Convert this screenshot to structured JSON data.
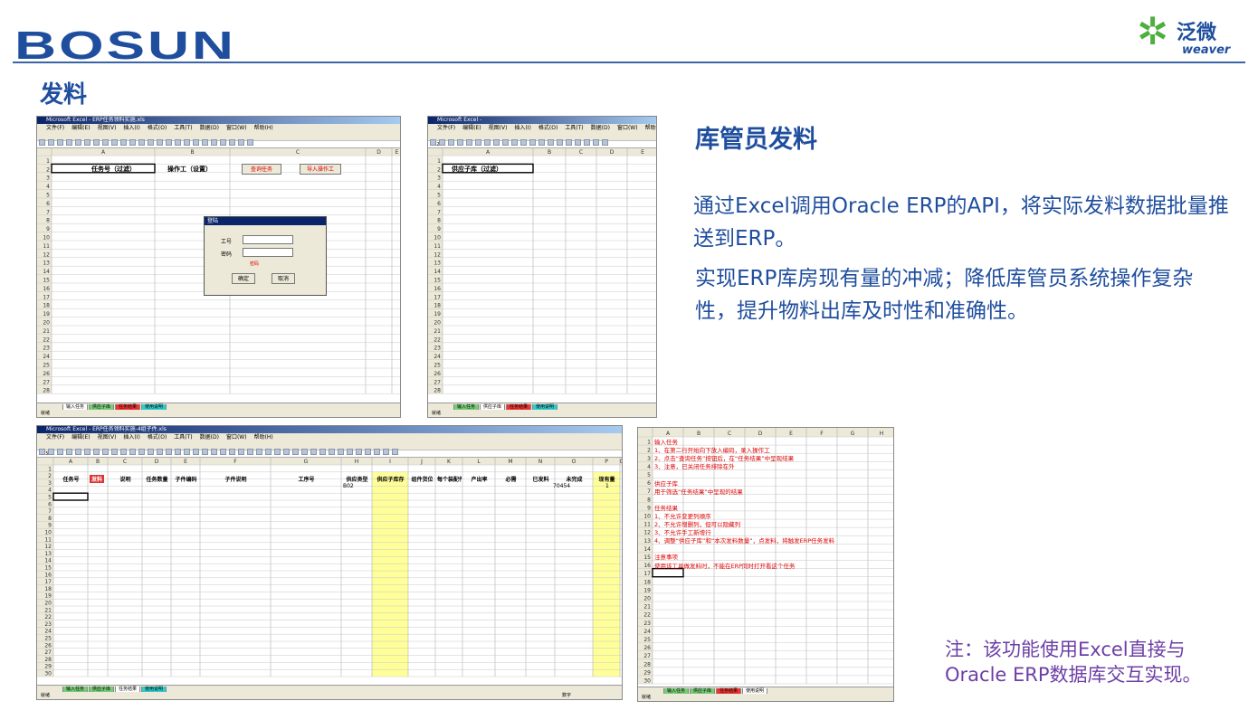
{
  "header": {
    "brand": "BOSUN",
    "logo_cn": "泛微",
    "logo_en": "weaver",
    "section": "发料"
  },
  "right": {
    "title": "库管员发料",
    "p1": "通过Excel调用Oracle ERP的API，将实际发料数据批量推送到ERP。",
    "p2": "实现ERP库房现有量的冲减；降低库管员系统操作复杂性，提升物料出库及时性和准确性。"
  },
  "note": {
    "l1": "注：该功能使用Excel直接与",
    "l2": "Oracle ERP数据库交互实现。"
  },
  "colors": {
    "brand": "#1f4e9e",
    "note": "#6d3fa6",
    "highlight": "#ffff99"
  },
  "common": {
    "title": "Microsoft Excel - ERP任务领料实施.xls",
    "menus": [
      "文件(F)",
      "编辑(E)",
      "视图(V)",
      "插入(I)",
      "格式(O)",
      "工具(T)",
      "数据(D)",
      "窗口(W)",
      "帮助(H)"
    ],
    "tabs": [
      "输入任务",
      "供应子库",
      "任务结果",
      "使用说明"
    ],
    "status": "就绪"
  },
  "s1": {
    "cols": [
      "A",
      "B",
      "C",
      "D",
      "E"
    ],
    "h_a": "任务号（过滤）",
    "h_b": "操作工（设置）",
    "btn1": "查询任务",
    "btn2": "导入操作工",
    "dlg_title": "登陆",
    "dlg_user": "工号",
    "dlg_pwd": "密码",
    "dlg_msg": "密码",
    "dlg_ok": "确定",
    "dlg_cancel": "取消",
    "name_box": ""
  },
  "s2": {
    "title": "Microsoft Excel -",
    "cols": [
      "A",
      "B",
      "C",
      "D",
      "E"
    ],
    "h_a": "供应子库（过滤）",
    "name_box": "A2"
  },
  "s3": {
    "title": "Microsoft Excel - ERP任务领料实施-4组子件.xls",
    "name_box": "A5",
    "cols": [
      "A",
      "B",
      "C",
      "D",
      "E",
      "F",
      "G",
      "H",
      "I",
      "J",
      "K",
      "L",
      "M",
      "N",
      "O",
      "P",
      "Q"
    ],
    "headers": [
      "任务号",
      "发料",
      "说明",
      "任务数量",
      "子件编码",
      "子件说明",
      "工序号",
      "供应类型",
      "供应子库存",
      "组件货位",
      "每个装配件",
      "产出率",
      "必需",
      "已发料",
      "未完成",
      "现有量",
      "本次发料数量"
    ],
    "val_i": "B02",
    "val_p": "70454",
    "val_q": "1",
    "status_right": "数字"
  },
  "s4": {
    "cols": [
      "A",
      "B",
      "C",
      "D",
      "E",
      "F",
      "G",
      "H"
    ],
    "lines": [
      "输入任务",
      "1、在第二行开始向下放入编码，录入操作工",
      "2、点击“查询任务”按钮后，在“任务结果”中呈现结果",
      "3、注意，已关闭任务排除在外",
      "",
      "供应子库",
      "用于筛选“任务结果”中呈现的结果",
      "",
      "任务结果",
      "1、不允许变更列顺序",
      "2、不允许增删列，但可以隐藏列",
      "3、不允许手工新增行",
      "4、调整“供应子库”和“本次发料数量”，点发料，将触发ERP任务发料",
      "",
      "注意事项",
      "使用该工具做发料时，不能在ERP同时打开看这个任务"
    ]
  }
}
